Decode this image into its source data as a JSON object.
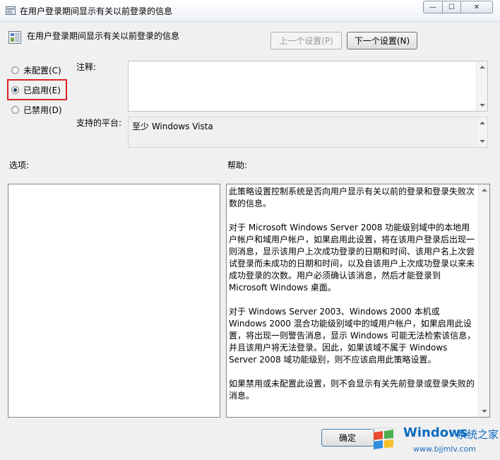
{
  "window": {
    "title": "在用户登录期间显示有关以前登录的信息",
    "controls": {
      "minimize": "—",
      "maximize": "☐",
      "close": "✕"
    }
  },
  "header": {
    "policy_name": "在用户登录期间显示有关以前登录的信息",
    "prev_label": "上一个设置(P)",
    "next_label": "下一个设置(N)"
  },
  "state": {
    "options": [
      {
        "label": "未配置(C)",
        "checked": false
      },
      {
        "label": "已启用(E)",
        "checked": true
      },
      {
        "label": "已禁用(D)",
        "checked": false
      }
    ],
    "highlight_color": "#d9232a"
  },
  "comment": {
    "label": "注释:",
    "value": ""
  },
  "platform": {
    "label": "支持的平台:",
    "value": "至少 Windows Vista"
  },
  "options_section": {
    "label": "选项:"
  },
  "help_section": {
    "label": "帮助:",
    "paragraphs": [
      "此策略设置控制系统是否向用户显示有关以前的登录和登录失败次数的信息。",
      "对于 Microsoft Windows Server 2008 功能级别域中的本地用户帐户和域用户帐户，如果启用此设置，将在该用户登录后出现一则消息，显示该用户上次成功登录的日期和时间、该用户名上次尝试登录而未成功的日期和时间，以及自该用户上次成功登录以来未成功登录的次数。用户必须确认该消息，然后才能登录到 Microsoft Windows 桌面。",
      "对于 Windows Server 2003、Windows 2000 本机或 Windows 2000 混合功能级别域中的域用户帐户，如果启用此设置，将出现一则警告消息，显示 Windows 可能无法检索该信息，并且该用户将无法登录。因此，如果该域不属于 Windows Server 2008 域功能级别，则不应该启用此策略设置。",
      "如果禁用或未配置此设置，则不会显示有关先前登录或登录失败的消息。"
    ]
  },
  "footer": {
    "ok_label": "确定"
  },
  "watermark": {
    "brand": "Windows",
    "cn_text": "系统之家",
    "url": "www.bjjmlv.com"
  }
}
